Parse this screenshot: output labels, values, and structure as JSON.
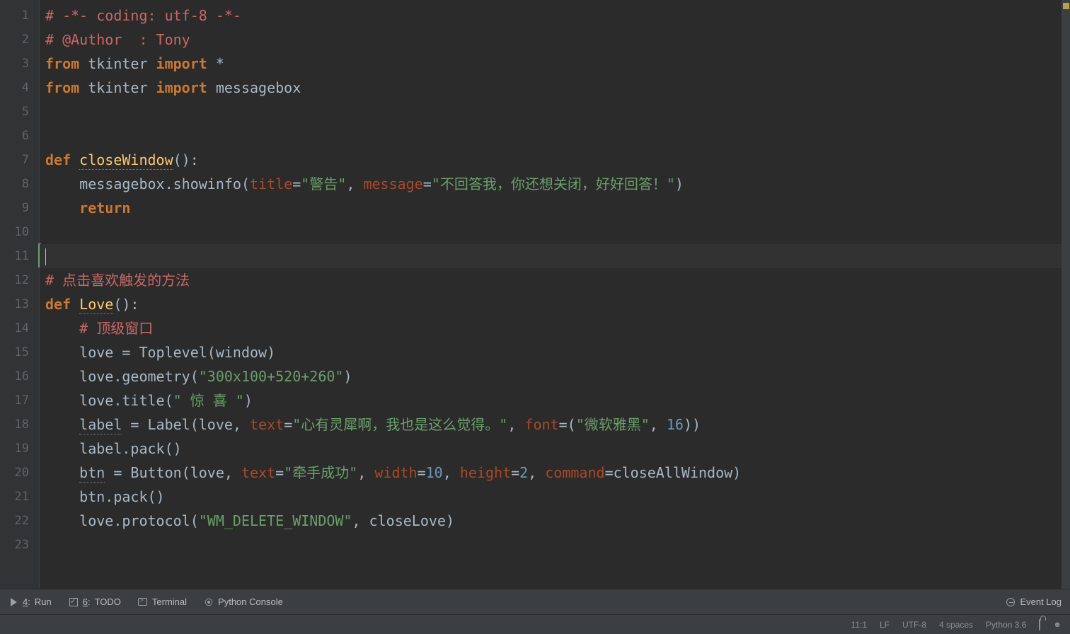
{
  "code": {
    "line1": "# -*- coding: utf-8 -*-",
    "line2": "# @Author  : Tony",
    "line3": {
      "kw1": "from",
      "mod": " tkinter ",
      "kw2": "import",
      "star": " *"
    },
    "line4": {
      "kw1": "from",
      "mod": " tkinter ",
      "kw2": "import",
      "name": " messagebox"
    },
    "line7": {
      "kw": "def ",
      "name": "closeWindow",
      "tail": "():"
    },
    "line8": {
      "indent": "    ",
      "call": "messagebox.showinfo(",
      "p1": "title",
      "eq1": "=",
      "s1": "\"警告\"",
      "comma1": ", ",
      "p2": "message",
      "eq2": "=",
      "s2": "\"不回答我，你还想关闭，好好回答！\"",
      "close": ")"
    },
    "line9": {
      "indent": "    ",
      "kw": "return"
    },
    "line12": "# 点击喜欢触发的方法",
    "line13": {
      "kw": "def ",
      "name": "Love",
      "tail": "():"
    },
    "line14": {
      "indent": "    ",
      "text": "# 顶级窗口"
    },
    "line15": {
      "indent": "    ",
      "text": "love = Toplevel(window)"
    },
    "line16": {
      "indent": "    ",
      "pre": "love.geometry(",
      "s": "\"300x100+520+260\"",
      "post": ")"
    },
    "line17": {
      "indent": "    ",
      "pre": "love.title(",
      "s": "\" 惊 喜 \"",
      "post": ")"
    },
    "line18": {
      "indent": "    ",
      "var": "label",
      "eq": " = ",
      "call": "Label(love, ",
      "p1": "text",
      "s1": "\"心有灵犀啊，我也是这么觉得。\"",
      "comma": ", ",
      "p2": "font",
      "open": "=(",
      "s2": "\"微软雅黑\"",
      "c2": ", ",
      "n": "16",
      "close": "))"
    },
    "line19": {
      "indent": "    ",
      "text": "label.pack()"
    },
    "line20": {
      "indent": "    ",
      "var": "btn",
      "eq": " = ",
      "call": "Button(love, ",
      "p1": "text",
      "s1": "\"牵手成功\"",
      "c1": ", ",
      "p2": "width",
      "n2": "10",
      "c2": ", ",
      "p3": "height",
      "n3": "2",
      "c3": ", ",
      "p4": "command",
      "tail": "=closeAllWindow)"
    },
    "line21": {
      "indent": "    ",
      "text": "btn.pack()"
    },
    "line22": {
      "indent": "    ",
      "pre": "love.protocol(",
      "s": "\"WM_DELETE_WINDOW\"",
      "post": ", closeLove)"
    }
  },
  "lineNumbers": [
    "1",
    "2",
    "3",
    "4",
    "5",
    "6",
    "7",
    "8",
    "9",
    "10",
    "11",
    "12",
    "13",
    "14",
    "15",
    "16",
    "17",
    "18",
    "19",
    "20",
    "21",
    "22",
    "23"
  ],
  "toolWindows": {
    "run": {
      "key": "4",
      "label": "Run"
    },
    "todo": {
      "key": "6",
      "label": "TODO"
    },
    "terminal": {
      "label": "Terminal"
    },
    "pyconsole": {
      "label": "Python Console"
    },
    "eventlog": {
      "label": "Event Log"
    }
  },
  "status": {
    "pos": "11:1",
    "lf": "LF",
    "encoding": "UTF-8",
    "indent": "4 spaces",
    "interpreter": "Python 3.6"
  }
}
